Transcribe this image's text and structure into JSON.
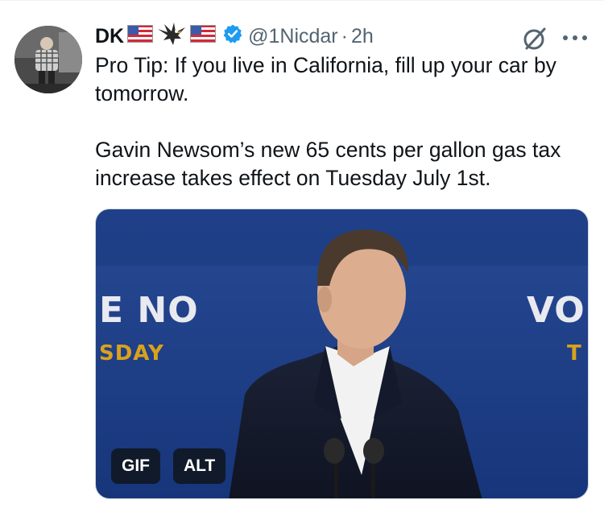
{
  "author": {
    "name": "DK",
    "name_emoji": [
      "us-flag-icon",
      "eagle-icon",
      "us-flag-icon"
    ],
    "handle": "@1Nicdar",
    "separator": "·",
    "time": "2h",
    "verified": true
  },
  "tweet": {
    "paragraph_1": "Pro Tip: If you live in California, fill up your car by tomorrow.",
    "paragraph_2": "Gavin Newsom’s new 65 cents per gallon gas tax increase takes effect on Tuesday July 1st."
  },
  "media": {
    "gif_label": "GIF",
    "alt_label": "ALT",
    "backdrop_left_big": "E NO",
    "backdrop_left_small": "SDAY",
    "backdrop_right_big": "VO",
    "backdrop_right_small": "T"
  },
  "icons": {
    "verified": "verified-badge-icon",
    "grok": "grok-icon",
    "more": "more-icon"
  },
  "colors": {
    "text": "#0f1419",
    "secondary": "#536471",
    "verified": "#1d9bf0",
    "backdrop_blue": "#1e3f8a",
    "backdrop_yellow": "#d9a21c"
  }
}
